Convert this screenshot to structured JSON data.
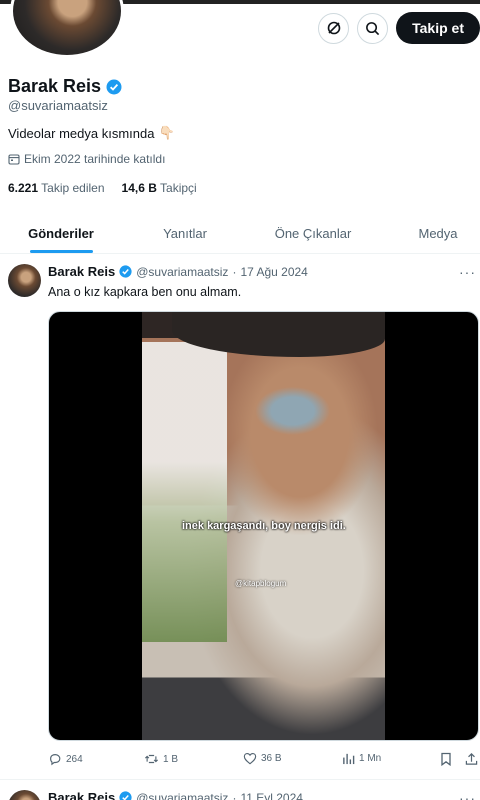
{
  "header": {
    "follow_label": "Takip et",
    "icons": [
      "grok-icon",
      "search-icon"
    ]
  },
  "profile": {
    "name": "Barak Reis",
    "handle": "@suvariamaatsiz",
    "bio": "Videolar medya kısmında",
    "bio_emoji": "👇🏻",
    "joined": "Ekim 2022 tarihinde katıldı",
    "following_count": "6.221",
    "following_label": "Takip edilen",
    "followers_count": "14,6 B",
    "followers_label": "Takipçi",
    "verified_color": "#1d9bf0"
  },
  "tabs": [
    {
      "label": "Gönderiler",
      "active": true
    },
    {
      "label": "Yanıtlar",
      "active": false
    },
    {
      "label": "Öne Çıkanlar",
      "active": false
    },
    {
      "label": "Medya",
      "active": false
    }
  ],
  "tweets": [
    {
      "name": "Barak Reis",
      "handle": "@suvariamaatsiz",
      "sep": "·",
      "date": "17 Ağu 2024",
      "text": "Ana o kız kapkara ben onu almam.",
      "media": {
        "subtitle": "inek kargaşandı, boy nergis idi.",
        "watermark": "@kitapblogum"
      },
      "replies": "264",
      "reposts": "1 B",
      "likes": "36 B",
      "views": "1 Mn"
    },
    {
      "name": "Barak Reis",
      "handle": "@suvariamaatsiz",
      "sep": "·",
      "date": "11 Eyl 2024"
    }
  ],
  "more_label": "···",
  "accent_color": "#1d9bf0"
}
